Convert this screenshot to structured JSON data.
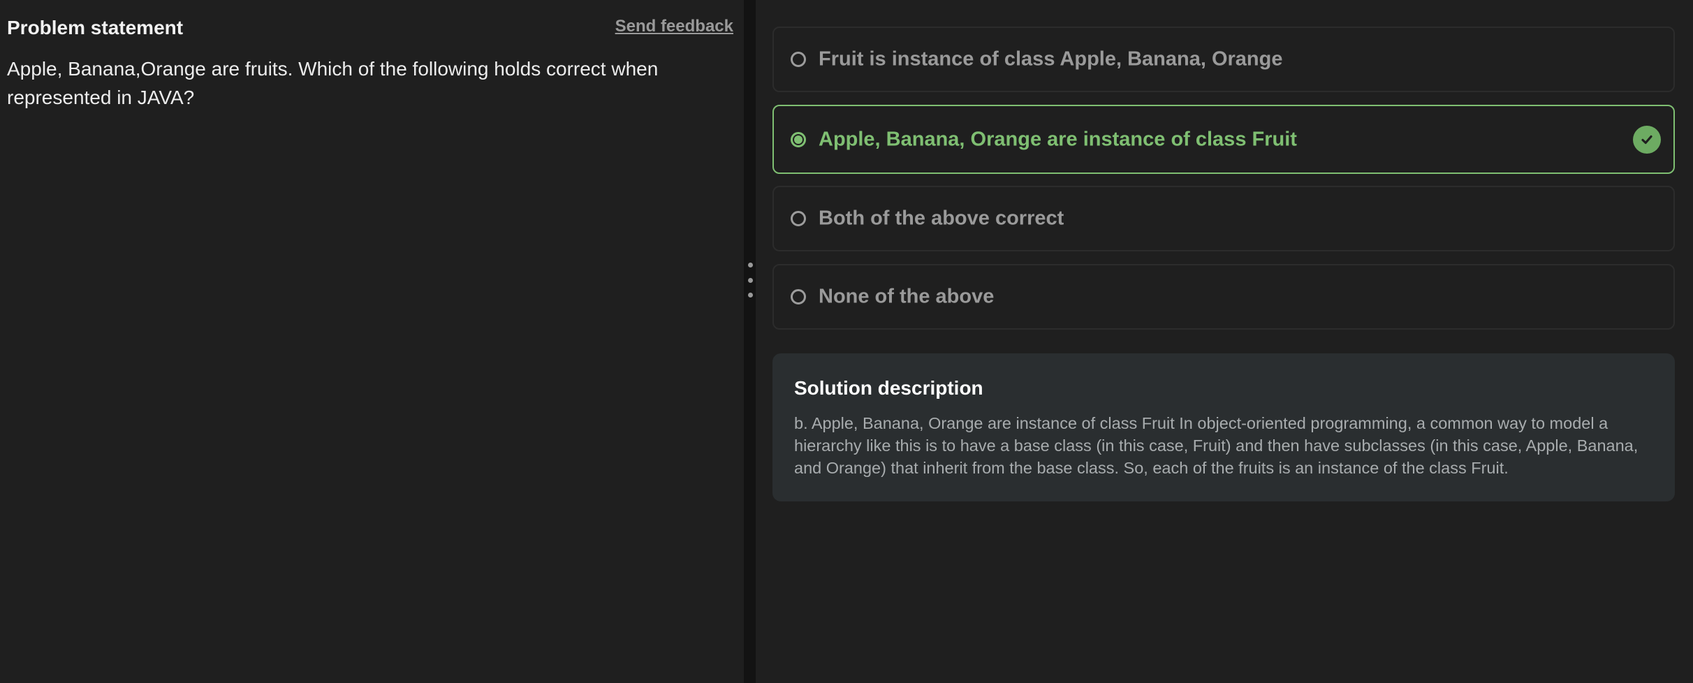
{
  "problem": {
    "title": "Problem statement",
    "feedback_label": "Send feedback",
    "text": "Apple, Banana,Orange are fruits. Which of the following holds correct when represented in JAVA?"
  },
  "options": [
    {
      "label": "Fruit is instance of class Apple, Banana, Orange",
      "selected": false,
      "correct": false
    },
    {
      "label": "Apple, Banana, Orange are instance of class Fruit",
      "selected": true,
      "correct": true
    },
    {
      "label": "Both of the above correct",
      "selected": false,
      "correct": false
    },
    {
      "label": "None of the above",
      "selected": false,
      "correct": false
    }
  ],
  "solution": {
    "title": "Solution description",
    "text": "b. Apple, Banana, Orange are instance of class Fruit In object-oriented programming, a common way to model a hierarchy like this is to have a base class (in this case, Fruit) and then have subclasses (in this case, Apple, Banana, and Orange) that inherit from the base class. So, each of the fruits is an instance of the class Fruit."
  },
  "colors": {
    "background": "#1f1f1f",
    "correct": "#7fbf72",
    "muted_text": "#9a9a9a",
    "solution_bg": "#2a2e30"
  },
  "icons": {
    "correct_badge": "check-icon",
    "resize_handle": "vertical-dots-icon"
  }
}
